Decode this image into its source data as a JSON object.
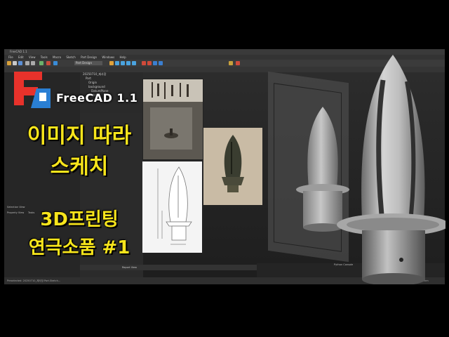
{
  "window": {
    "title": "FreeCAD 1.1",
    "menu": [
      "File",
      "Edit",
      "View",
      "Tools",
      "Macro",
      "Sketch",
      "Part Design",
      "Windows",
      "Help"
    ],
    "workbench": "Part Design"
  },
  "tree": {
    "items": [
      "20250710_제사장",
      "Part",
      "Origin",
      "background",
      "DatumPlane",
      "Sketch"
    ]
  },
  "panels": {
    "property_view": "Property View",
    "tasks": "Tasks",
    "selection_view": "Selection View",
    "report_view": "Report View",
    "python_console": "Python Console",
    "view_tab": "View",
    "data_tab": "Data"
  },
  "status": {
    "left": "Preselected: 20250710_제사장.Part.Sketch...",
    "right": "128.14 mm x 102.38 mm"
  },
  "overlay": {
    "brand": "FreeCAD 1.1",
    "line1": "이미지 따라",
    "line2": "스케치",
    "line3": "3D프린팅",
    "line4": "연극소품 #1"
  },
  "colors": {
    "title_yellow": "#f7e51c",
    "logo_red": "#e8322b",
    "logo_blue": "#2a7fd4"
  }
}
